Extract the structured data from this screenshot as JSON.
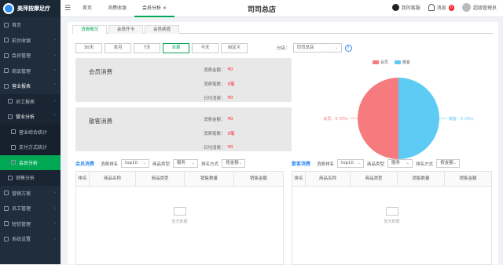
{
  "app": {
    "logo_text": "美萍按摩足疗"
  },
  "sidebar": {
    "items": [
      {
        "label": "首页",
        "type": "top"
      },
      {
        "label": "前台收银",
        "type": "top",
        "arrow": "›"
      },
      {
        "label": "会员管理",
        "type": "top",
        "arrow": "›"
      },
      {
        "label": "商品管理",
        "type": "top",
        "arrow": "›"
      },
      {
        "label": "营业报表",
        "type": "top-open",
        "arrow": "˅"
      },
      {
        "label": "员工报表",
        "type": "sub",
        "arrow": "›"
      },
      {
        "label": "营业分析",
        "type": "sub-open",
        "arrow": "˅"
      },
      {
        "label": "营业综合统计",
        "type": "sub2"
      },
      {
        "label": "支付方式统计",
        "type": "sub2"
      },
      {
        "label": "会员分析",
        "type": "sub2-active"
      },
      {
        "label": "销售分析",
        "type": "sub"
      },
      {
        "label": "营销方案",
        "type": "top",
        "arrow": "›"
      },
      {
        "label": "员工管理",
        "type": "top",
        "arrow": "›"
      },
      {
        "label": "短信管理",
        "type": "top",
        "arrow": "›"
      },
      {
        "label": "系统设置",
        "type": "top",
        "arrow": "›"
      }
    ]
  },
  "topbar": {
    "tabs": [
      {
        "label": "首页"
      },
      {
        "label": "消费收银"
      },
      {
        "label": "会员分析 ×"
      }
    ],
    "store_title": "司司总店",
    "service": "我的客服",
    "notice": "消息",
    "notice_count": "0",
    "user": "超级管理员"
  },
  "subtabs": [
    {
      "label": "消费概况"
    },
    {
      "label": "会员开卡"
    },
    {
      "label": "会员续值"
    }
  ],
  "ranges": [
    "30天",
    "本月",
    "7天",
    "本周",
    "今天",
    "自定义"
  ],
  "store_filter": {
    "label": "分店：",
    "value": "司司总店"
  },
  "member_card": {
    "title": "会员消费",
    "rows": [
      {
        "label": "消费金额：",
        "value": "¥0"
      },
      {
        "label": "消费笔数：",
        "value": "0笔"
      },
      {
        "label": "日均消费：",
        "value": "¥0"
      }
    ]
  },
  "guest_card": {
    "title": "散客消费",
    "rows": [
      {
        "label": "消费金额：",
        "value": "¥0"
      },
      {
        "label": "消费笔数：",
        "value": "0笔"
      },
      {
        "label": "日均消费：",
        "value": "¥0"
      }
    ]
  },
  "colors": {
    "member": "#f57b7f",
    "guest": "#5ecbf5",
    "accent": "#00a854"
  },
  "chart_data": {
    "type": "pie",
    "legend": [
      "会员",
      "散客"
    ],
    "slices": [
      {
        "name": "会员",
        "value": 0,
        "label": "会员：0 (0%)"
      },
      {
        "name": "散客",
        "value": 0,
        "label": "散客：0 (0%)"
      }
    ]
  },
  "member_section": {
    "title": "会员消费",
    "rank_label": "消费排名",
    "rank_value": "top10",
    "type_label": "商品类型",
    "type_value": "服务",
    "sort_label": "排名方式",
    "sort_value": "按金额",
    "columns": [
      "排名",
      "商品名称",
      "商品类型",
      "销售数量",
      "销售金额"
    ],
    "empty": "暂无数据"
  },
  "guest_section": {
    "title": "散客消费",
    "rank_label": "消费排名",
    "rank_value": "top10",
    "type_label": "商品类型",
    "type_value": "服务",
    "sort_label": "排名方式",
    "sort_value": "按金额",
    "columns": [
      "排名",
      "商品名称",
      "商品类型",
      "销售数量",
      "销售金额"
    ],
    "empty": "暂无数据"
  }
}
